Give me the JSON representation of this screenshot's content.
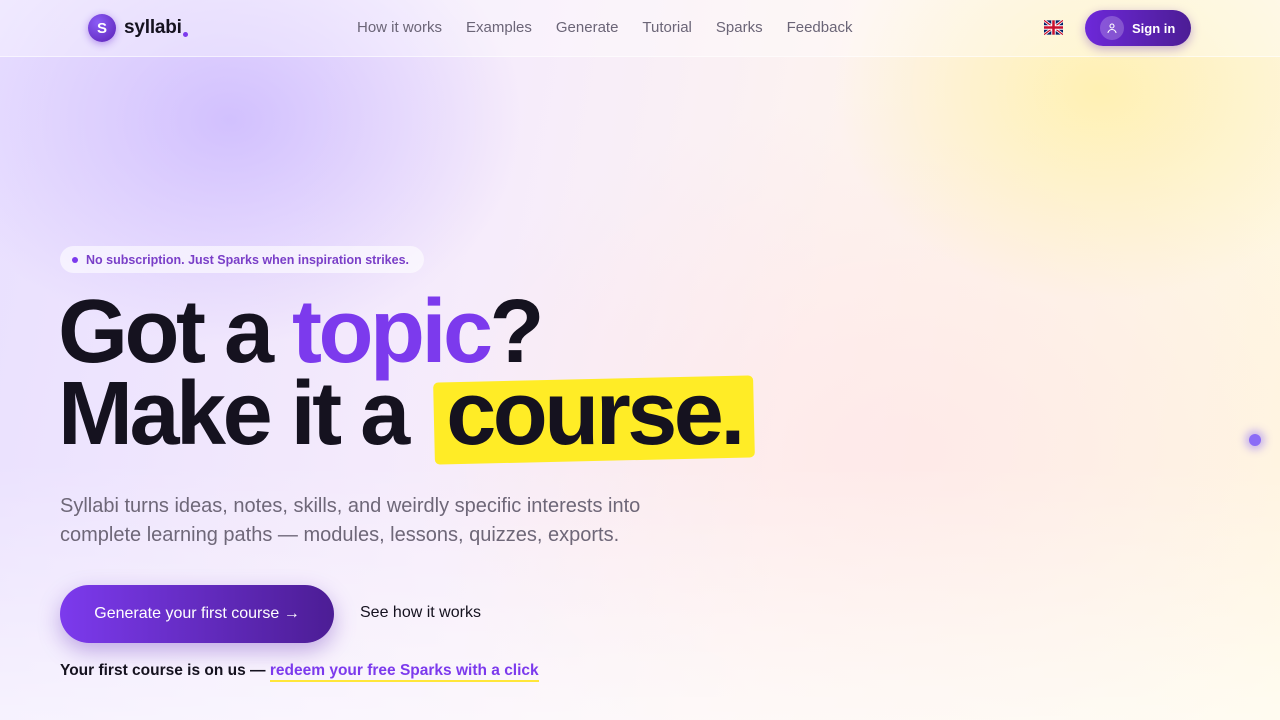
{
  "header": {
    "brand": {
      "mark": "S",
      "name": "syllabi",
      "icon": "syllabi-logo-icon"
    },
    "nav": [
      {
        "label": "How it works"
      },
      {
        "label": "Examples"
      },
      {
        "label": "Generate"
      },
      {
        "label": "Tutorial"
      },
      {
        "label": "Sparks"
      },
      {
        "label": "Feedback"
      }
    ],
    "language_icon": "uk-flag-icon",
    "signin": {
      "label": "Sign in",
      "icon": "user-icon"
    }
  },
  "hero": {
    "badge": "No subscription. Just Sparks when inspiration strikes.",
    "headline": {
      "line1_prefix": "Got a ",
      "line1_accent": "topic",
      "line1_suffix": "?",
      "line2_prefix": "Make it a",
      "line2_highlight": "course."
    },
    "subtitle": "Syllabi turns ideas, notes, skills, and weirdly specific interests into complete learning paths — modules, lessons, quizzes, exports.",
    "cta_primary": "Generate your first course →",
    "cta_secondary": "See how it works",
    "free_note_prefix": "Your first course is on us — ",
    "free_note_link": "redeem your free Sparks with a click"
  },
  "colors": {
    "brand_purple": "#7c3aed",
    "brand_purple_dark": "#4c1d95",
    "highlight_yellow": "#ffec26",
    "text_dark": "#15121f",
    "text_muted": "#6e6778"
  }
}
